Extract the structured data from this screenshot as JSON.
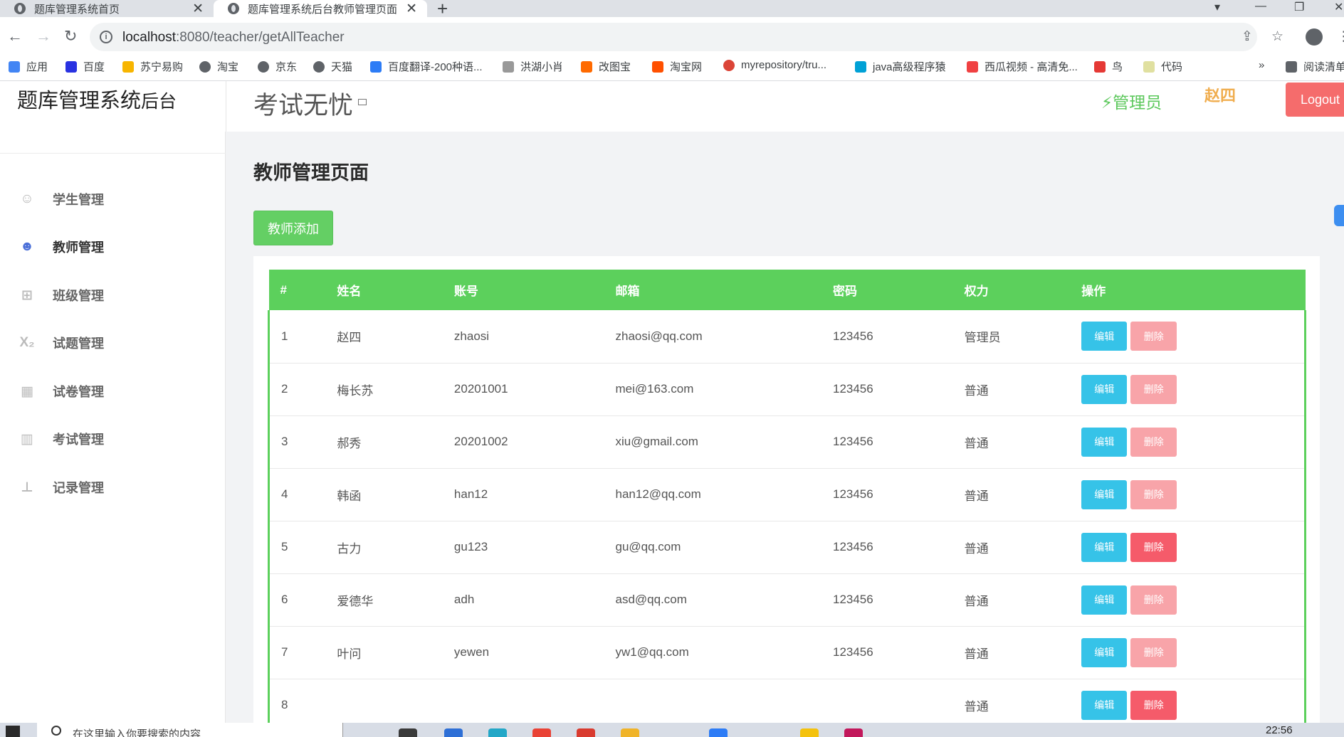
{
  "browser": {
    "tabs": [
      {
        "title": "题库管理系统首页"
      },
      {
        "title": "题库管理系统后台教师管理页面"
      }
    ],
    "url_host": "localhost",
    "url_path": ":8080/teacher/getAllTeacher",
    "bookmarks": [
      {
        "label": "应用",
        "color": "#4285f4"
      },
      {
        "label": "百度",
        "color": "#2932e1"
      },
      {
        "label": "苏宁易购",
        "color": "#f7b500"
      },
      {
        "label": "淘宝",
        "color": "#5f6368"
      },
      {
        "label": "京东",
        "color": "#5f6368"
      },
      {
        "label": "天猫",
        "color": "#5f6368"
      },
      {
        "label": "百度翻译-200种语...",
        "color": "#2d7cf6"
      },
      {
        "label": "洪湖小肖",
        "color": "#999999"
      },
      {
        "label": "改图宝",
        "color": "#ff6a00"
      },
      {
        "label": "淘宝网",
        "color": "#ff5000"
      },
      {
        "label": "myrepository/tru...",
        "color": "#db4437"
      },
      {
        "label": "java高级程序猿",
        "color": "#00a1d6"
      },
      {
        "label": "西瓜视频 - 高清免...",
        "color": "#f04142"
      },
      {
        "label": "鸟",
        "color": "#e53935"
      },
      {
        "label": "代码",
        "color": "#e0e0a0"
      },
      {
        "label": "阅读清单",
        "color": "#5f6368"
      }
    ]
  },
  "header": {
    "brand_main": "题库管理系统",
    "brand_small": "后台",
    "slogan": "考试无忧",
    "role": "⚡管理员",
    "user": "赵四",
    "logout": "Logout"
  },
  "sidebar": {
    "items": [
      {
        "label": "学生管理",
        "icon": "student-icon",
        "glyph": "☺"
      },
      {
        "label": "教师管理",
        "icon": "teacher-icon",
        "glyph": "☻"
      },
      {
        "label": "班级管理",
        "icon": "class-grid-icon",
        "glyph": "⊞"
      },
      {
        "label": "试题管理",
        "icon": "formula-icon",
        "glyph": "X₂"
      },
      {
        "label": "试卷管理",
        "icon": "table-icon",
        "glyph": "▦"
      },
      {
        "label": "考试管理",
        "icon": "map-icon",
        "glyph": "▥"
      },
      {
        "label": "记录管理",
        "icon": "sitemap-icon",
        "glyph": "⊥"
      }
    ],
    "active_index": 1
  },
  "main": {
    "page_title": "教师管理页面",
    "add_button": "教师添加",
    "table": {
      "columns": [
        "#",
        "姓名",
        "账号",
        "邮箱",
        "密码",
        "权力",
        "操作"
      ],
      "edit_label": "编辑",
      "delete_label": "删除",
      "rows": [
        {
          "id": "1",
          "name": "赵四",
          "account": "zhaosi",
          "email": "zhaosi@qq.com",
          "password": "123456",
          "role": "管理员",
          "delete_enabled": false
        },
        {
          "id": "2",
          "name": "梅长苏",
          "account": "20201001",
          "email": "mei@163.com",
          "password": "123456",
          "role": "普通",
          "delete_enabled": false
        },
        {
          "id": "3",
          "name": "郝秀",
          "account": "20201002",
          "email": "xiu@gmail.com",
          "password": "123456",
          "role": "普通",
          "delete_enabled": false
        },
        {
          "id": "4",
          "name": "韩函",
          "account": "han12",
          "email": "han12@qq.com",
          "password": "123456",
          "role": "普通",
          "delete_enabled": false
        },
        {
          "id": "5",
          "name": "古力",
          "account": "gu123",
          "email": "gu@qq.com",
          "password": "123456",
          "role": "普通",
          "delete_enabled": true
        },
        {
          "id": "6",
          "name": "爱德华",
          "account": "adh",
          "email": "asd@qq.com",
          "password": "123456",
          "role": "普通",
          "delete_enabled": false
        },
        {
          "id": "7",
          "name": "叶问",
          "account": "yewen",
          "email": "yw1@qq.com",
          "password": "123456",
          "role": "普通",
          "delete_enabled": false
        },
        {
          "id": "8",
          "name": "",
          "account": "",
          "email": "",
          "password": "",
          "role": "普通",
          "delete_enabled": true
        }
      ]
    }
  },
  "taskbar": {
    "search_placeholder": "在这里输入你要搜索的内容",
    "time": "22:56"
  }
}
